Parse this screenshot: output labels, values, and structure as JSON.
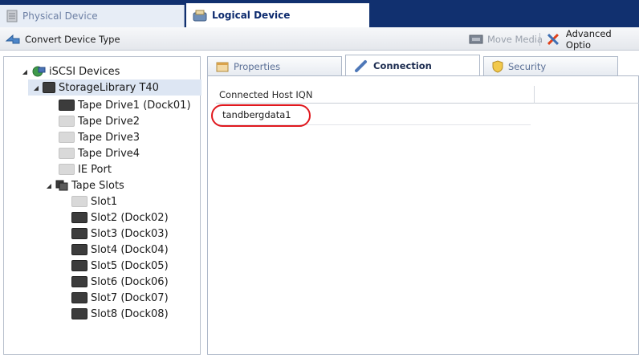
{
  "tabs": {
    "physical": "Physical Device",
    "logical": "Logical Device"
  },
  "toolbar": {
    "convert": "Convert Device Type",
    "move_media": "Move Media",
    "advanced": "Advanced Optio"
  },
  "tree": {
    "root": "iSCSI Devices",
    "library": "StorageLibrary T40",
    "drives": [
      "Tape Drive1 (Dock01)",
      "Tape Drive2",
      "Tape Drive3",
      "Tape Drive4"
    ],
    "ie_port": "IE Port",
    "slots_label": "Tape Slots",
    "slots": [
      "Slot1",
      "Slot2 (Dock02)",
      "Slot3 (Dock03)",
      "Slot4 (Dock04)",
      "Slot5 (Dock05)",
      "Slot6 (Dock06)",
      "Slot7 (Dock07)",
      "Slot8 (Dock08)"
    ]
  },
  "panel_tabs": {
    "properties": "Properties",
    "connection": "Connection",
    "security": "Security"
  },
  "table": {
    "header": "Connected Host IQN",
    "rows": [
      "tandbergdata1"
    ]
  },
  "colors": {
    "topbar": "#11306f",
    "highlight": "#e0181e"
  }
}
